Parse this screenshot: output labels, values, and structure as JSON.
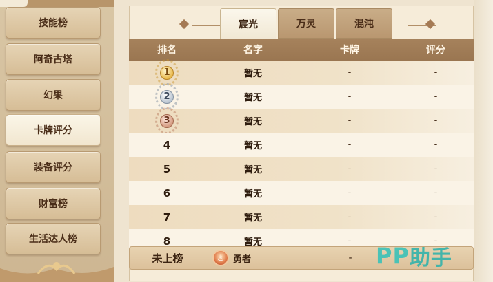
{
  "sidebar": {
    "items": [
      {
        "label": "技能榜",
        "active": false
      },
      {
        "label": "阿奇古塔",
        "active": false
      },
      {
        "label": "幻果",
        "active": false
      },
      {
        "label": "卡牌评分",
        "active": true
      },
      {
        "label": "装备评分",
        "active": false
      },
      {
        "label": "财富榜",
        "active": false
      },
      {
        "label": "生活达人榜",
        "active": false
      }
    ]
  },
  "tabs": [
    {
      "label": "宸光",
      "active": true
    },
    {
      "label": "万灵",
      "active": false
    },
    {
      "label": "混沌",
      "active": false
    }
  ],
  "table": {
    "headers": {
      "rank": "排名",
      "name": "名字",
      "card": "卡牌",
      "score": "评分"
    },
    "rows": [
      {
        "rank": "1",
        "medal": "gold",
        "name": "暂无",
        "card": "-",
        "score": "-"
      },
      {
        "rank": "2",
        "medal": "silver",
        "name": "暂无",
        "card": "-",
        "score": "-"
      },
      {
        "rank": "3",
        "medal": "bronze",
        "name": "暂无",
        "card": "-",
        "score": "-"
      },
      {
        "rank": "4",
        "name": "暂无",
        "card": "-",
        "score": "-"
      },
      {
        "rank": "5",
        "name": "暂无",
        "card": "-",
        "score": "-"
      },
      {
        "rank": "6",
        "name": "暂无",
        "card": "-",
        "score": "-"
      },
      {
        "rank": "7",
        "name": "暂无",
        "card": "-",
        "score": "-"
      },
      {
        "rank": "8",
        "name": "暂无",
        "card": "-",
        "score": "-"
      }
    ]
  },
  "footer": {
    "label": "未上榜",
    "player_name": "勇者",
    "player_icon": "flame-avatar-icon",
    "card": "-"
  },
  "watermark": {
    "latin": "PP",
    "han": "助手"
  },
  "colors": {
    "header_bg": "#a6825c",
    "accent_teal": "#3ec2b8",
    "tab_active": "#fbf7ec",
    "tab_inactive": "#c9ad88"
  }
}
